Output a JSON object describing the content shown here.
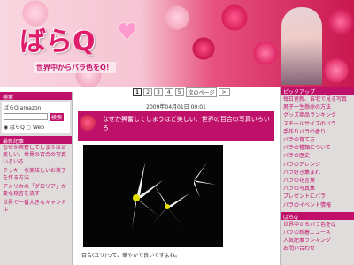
{
  "header": {
    "logo_text": "ばらQ",
    "tagline": "世界中からバラ色をQ！"
  },
  "nav": {
    "pages": [
      "1",
      "2",
      "3",
      "4",
      "5"
    ],
    "current": "1",
    "next": "次のページ"
  },
  "left": {
    "search_title": "検索",
    "search_label": "ばらQ",
    "search_label2": "amazon",
    "search_btn": "検索",
    "radio_options": [
      "ばらQ",
      "Web"
    ],
    "recent_title": "最新記事",
    "links": [
      "なぜか興奮してしまうほど美しい、世界の百合の写真いろいろ",
      "クッキーな美味しいお菓子を作る方法",
      "アメリカの「グロリア」が変な発言を流す",
      "世界で一番大きなキャンドル"
    ]
  },
  "post": {
    "date": "2009年04月01日 00:01",
    "title": "なぜか興奮してしまうほど美しい、世界の百合の写真いろいろ",
    "caption": "百合(ユリ)って、華やかで良いですよね。"
  },
  "right": {
    "title": "ピックアップ",
    "links": [
      "毎日更新、自宅で見る写真",
      "男子一生懸命の方法",
      "グッズ商品ランキング",
      "スモールサイズのバラ",
      "手作りバラの香り",
      "バラの育て方",
      "バラの種類について",
      "バラの歴史",
      "バラのアレンジ",
      "バラ好き集まれ",
      "バラの花言葉",
      "バラの写真集",
      "プレゼントにバラ",
      "バラのイベント情報"
    ],
    "title2": "ばらQ",
    "links2": [
      "世界中からバラ色をQ",
      "バラの新着ニュース",
      "人気記事ランキング",
      "お問い合わせ"
    ]
  }
}
